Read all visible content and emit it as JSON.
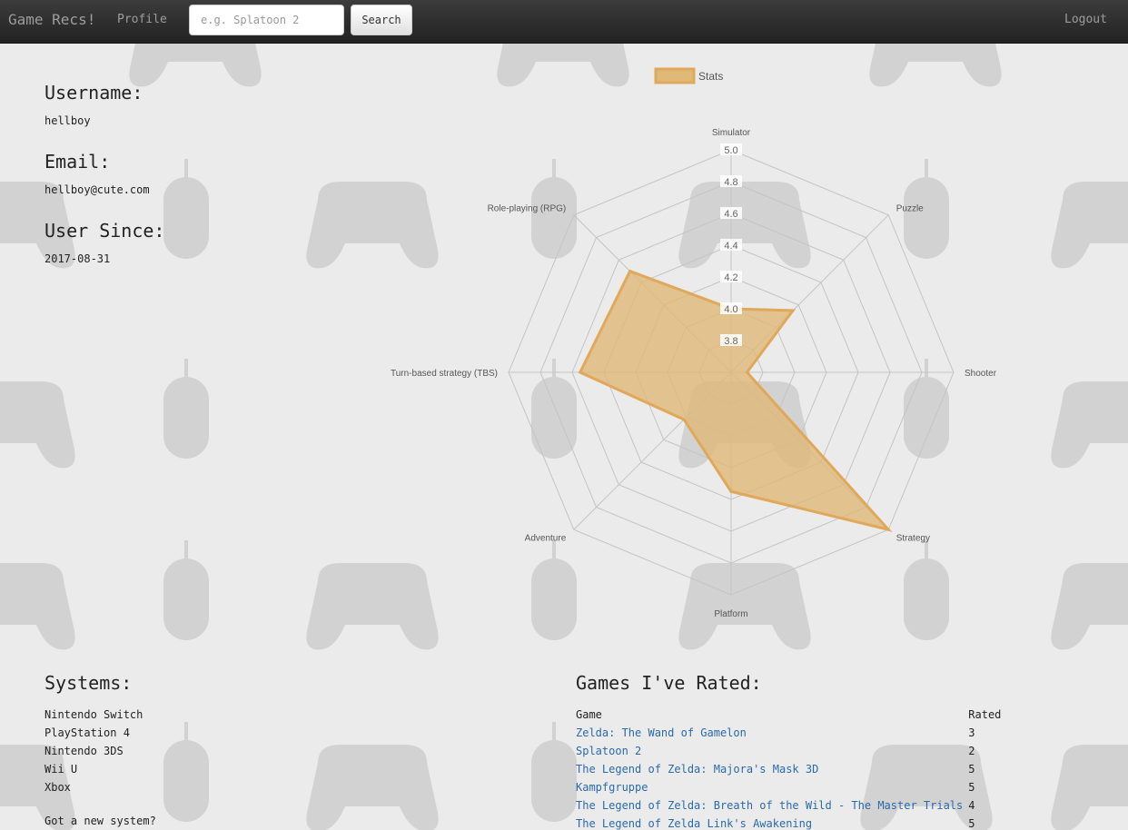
{
  "navbar": {
    "brand": "Game Recs!",
    "profile_link": "Profile",
    "search_placeholder": "e.g. Splatoon 2",
    "search_button": "Search",
    "logout_link": "Logout"
  },
  "profile": {
    "username_label": "Username:",
    "username": "hellboy",
    "email_label": "Email:",
    "email": "hellboy@cute.com",
    "since_label": "User Since:",
    "since": "2017-08-31"
  },
  "systems": {
    "heading": "Systems:",
    "items": [
      "Nintendo Switch",
      "PlayStation 4",
      "Nintendo 3DS",
      "Wii U",
      "Xbox"
    ],
    "prompt": "Got a new system?"
  },
  "games": {
    "heading": "Games I've Rated:",
    "columns": [
      "Game",
      "Rated"
    ],
    "rows": [
      {
        "game": "Zelda: The Wand of Gamelon",
        "rated": "3"
      },
      {
        "game": "Splatoon 2",
        "rated": "2"
      },
      {
        "game": "The Legend of Zelda: Majora's Mask 3D",
        "rated": "5"
      },
      {
        "game": "Kampfgruppe",
        "rated": "5"
      },
      {
        "game": "The Legend of Zelda: Breath of the Wild - The Master Trials",
        "rated": "4"
      },
      {
        "game": "The Legend of Zelda Link's Awakening",
        "rated": "5"
      }
    ]
  },
  "colors": {
    "navbar": "#2b2b2b",
    "link": "#2a6aab",
    "series_fill": "#e0b878",
    "series_stroke": "#e0a85a"
  },
  "chart_data": {
    "type": "radar",
    "categories": [
      "Simulator",
      "Puzzle",
      "Shooter",
      "Strategy",
      "Platform",
      "Adventure",
      "Turn-based strategy (TBS)",
      "Role-playing (RPG)"
    ],
    "series": [
      {
        "name": "Stats",
        "values": [
          4.0,
          4.15,
          3.7,
          5.0,
          4.35,
          4.02,
          4.55,
          4.5
        ]
      }
    ],
    "rlim": [
      3.6,
      5.0
    ],
    "ticks": [
      "3.8",
      "4.0",
      "4.2",
      "4.4",
      "4.6",
      "4.8",
      "5.0"
    ],
    "legend": "top"
  }
}
